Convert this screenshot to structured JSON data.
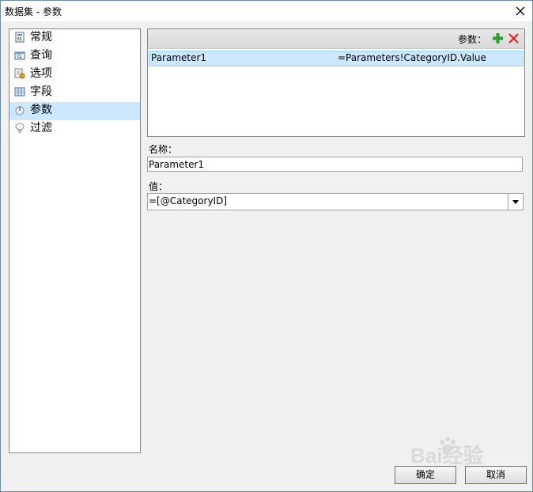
{
  "window": {
    "title": "数据集 - 参数"
  },
  "sidebar": {
    "items": [
      {
        "label": "常规",
        "icon": "general-icon",
        "selected": false
      },
      {
        "label": "查询",
        "icon": "query-icon",
        "selected": false
      },
      {
        "label": "选项",
        "icon": "options-icon",
        "selected": false
      },
      {
        "label": "字段",
        "icon": "fields-icon",
        "selected": false
      },
      {
        "label": "参数",
        "icon": "parameters-icon",
        "selected": true
      },
      {
        "label": "过滤",
        "icon": "filter-icon",
        "selected": false
      }
    ]
  },
  "parameters": {
    "header_label": "参数：",
    "rows": [
      {
        "name": "Parameter1",
        "value": "=Parameters!CategoryID.Value"
      }
    ]
  },
  "form": {
    "name_label": "名称：",
    "name_value": "Parameter1",
    "value_label": "值：",
    "value_value": "=[@CategoryID]"
  },
  "buttons": {
    "ok": "确定",
    "cancel": "取消"
  },
  "watermark": {
    "text": "Bai经验"
  },
  "colors": {
    "selection": "#cce8ff",
    "add": "#2ca02c",
    "delete": "#e02020"
  }
}
